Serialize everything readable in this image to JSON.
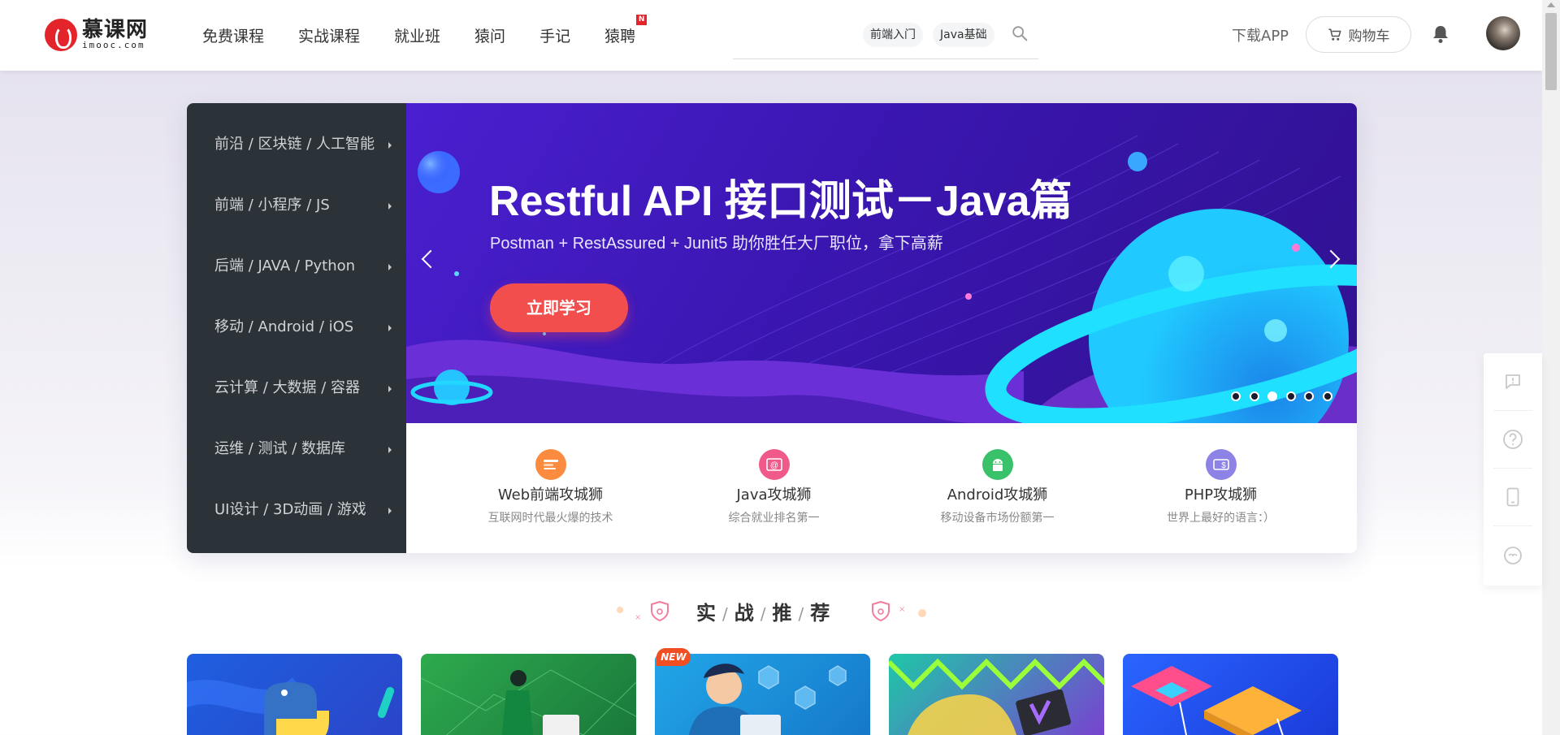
{
  "logo": {
    "cn": "慕课网",
    "en": "imooc.com"
  },
  "nav": {
    "items": [
      {
        "label": "免费课程"
      },
      {
        "label": "实战课程"
      },
      {
        "label": "就业班"
      },
      {
        "label": "猿问"
      },
      {
        "label": "手记"
      },
      {
        "label": "猿聘",
        "badge": "N"
      }
    ]
  },
  "search": {
    "placeholder": "",
    "tags": [
      "前端入门",
      "Java基础"
    ]
  },
  "header": {
    "download_app": "下载APP",
    "cart_label": "购物车"
  },
  "categories": [
    "前沿 / 区块链 / 人工智能",
    "前端 / 小程序 / JS",
    "后端 / JAVA / Python",
    "移动 / Android / iOS",
    "云计算 / 大数据 / 容器",
    "运维 / 测试 / 数据库",
    "UI设计 / 3D动画 / 游戏"
  ],
  "banner": {
    "title": "Restful API 接口测试－Java篇",
    "subtitle": "Postman + RestAssured + Junit5 助你胜任大厂职位，拿下高薪",
    "button": "立即学习",
    "slide_count": 6,
    "active_slide": 3
  },
  "tracks": [
    {
      "title": "Web前端攻城狮",
      "desc": "互联网时代最火爆的技术",
      "color": "#fb8b3e"
    },
    {
      "title": "Java攻城狮",
      "desc": "综合就业排名第一",
      "color": "#ef5a8b"
    },
    {
      "title": "Android攻城狮",
      "desc": "移动设备市场份额第一",
      "color": "#39c26a"
    },
    {
      "title": "PHP攻城狮",
      "desc": "世界上最好的语言：）",
      "color": "#8d82e6"
    }
  ],
  "section": {
    "chars": [
      "实",
      "战",
      "推",
      "荐"
    ]
  },
  "new_badge": "NEW",
  "side_tools": [
    "feedback-icon",
    "help-icon",
    "mobile-icon",
    "chat-icon"
  ]
}
